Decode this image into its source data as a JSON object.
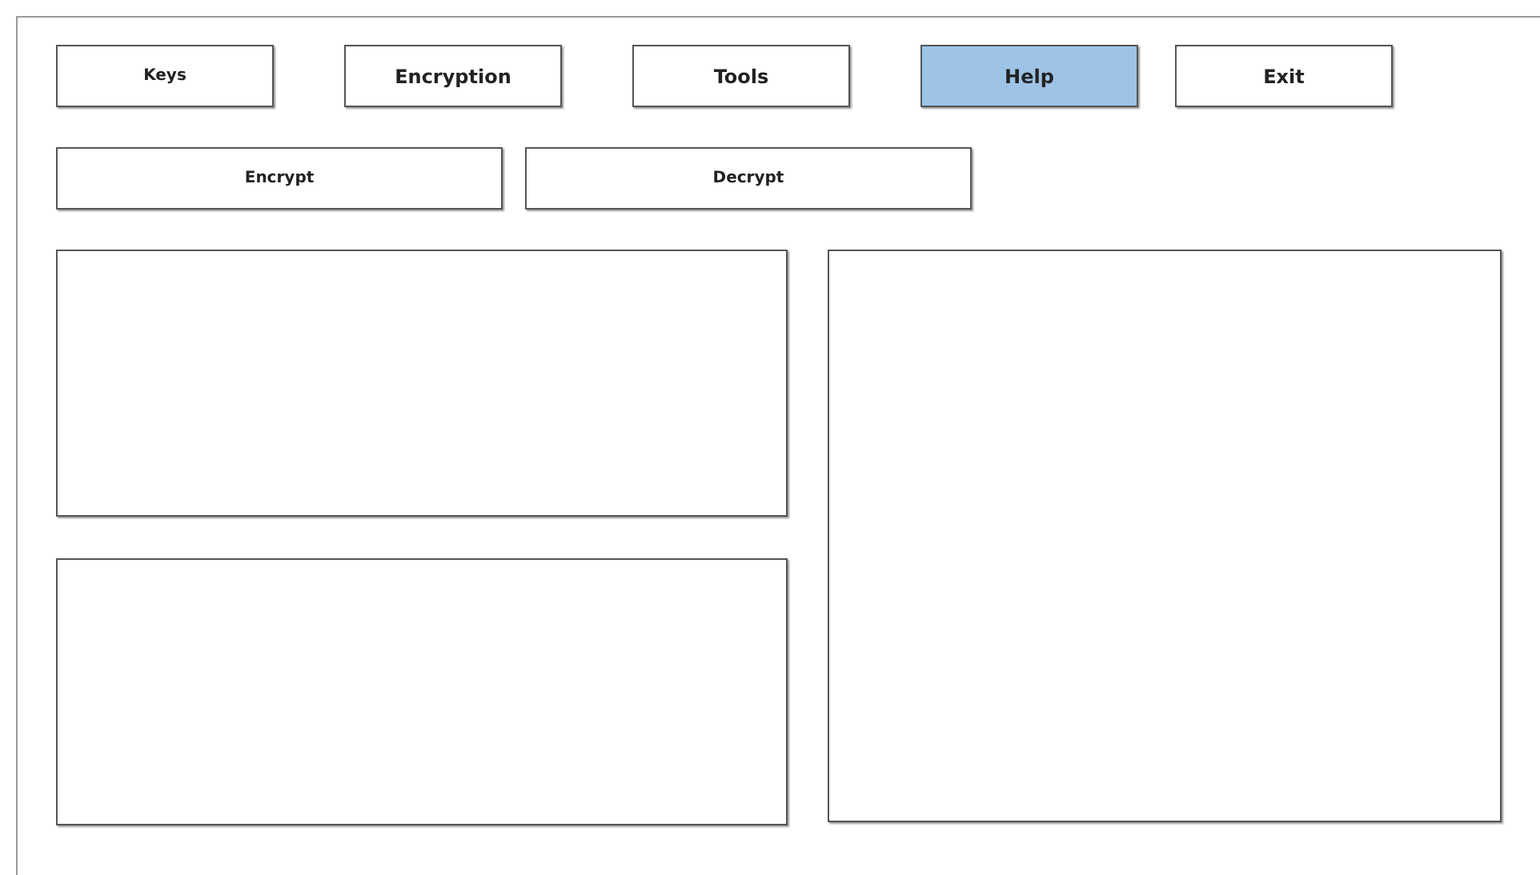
{
  "menu": [
    {
      "label": "Keys",
      "selected": false
    },
    {
      "label": "Encryption",
      "selected": false
    },
    {
      "label": "Tools",
      "selected": false
    },
    {
      "label": "Help",
      "selected": true
    },
    {
      "label": "Exit",
      "selected": false
    }
  ],
  "actions": [
    "Encrypt",
    "Decrypt"
  ]
}
